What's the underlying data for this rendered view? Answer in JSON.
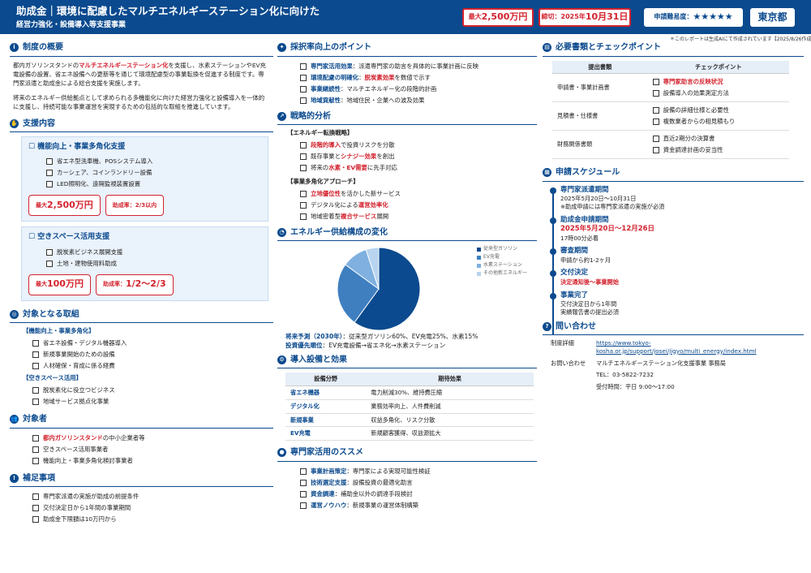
{
  "header": {
    "title": "助成金｜環境に配慮したマルチエネルギーステーション化に向けた",
    "subtitle": "経営力強化・設備導入等支援事業",
    "max_amount_prefix": "最大",
    "max_amount": "2,500万円",
    "deadline_label": "締切：",
    "deadline_year": "2025年",
    "deadline_date": "10月31日",
    "difficulty_label": "申請難易度：",
    "difficulty_stars": "★★★★★",
    "prefecture": "東京都"
  },
  "note": "＊このレポートは生成AIにて作成されています【2025/8/26作成】",
  "overview": {
    "title": "制度の概要",
    "p1_a": "都内ガソリンスタンドの",
    "p1_hl": "マルチエネルギーステーション化",
    "p1_b": "を支援し、水素ステーションやEV充電設備の設置、省エネ設備への更新等を通じて環境配慮型の事業転換を促進する制度です。専門家派遣と助成金による総合支援を実施します。",
    "p2": "将来のエネルギー供給拠点として求められる多機能化に向けた経営力強化と設備導入を一体的に支援し、持続可能な事業運営を実現するための包括的な取組を推進しています。"
  },
  "support": {
    "title": "支援内容",
    "box1": {
      "title": "機能向上・事業多角化支援",
      "items": [
        "省エネ型洗車機、POSシステム導入",
        "カーシェア、コインランドリー設備",
        "LED照明化、遠隔監視装置設置"
      ],
      "max_prefix": "最大",
      "max": "2,500万円",
      "rate": "助成率：2/3以内"
    },
    "box2": {
      "title": "空きスペース活用支援",
      "items": [
        "脱炭素ビジネス展開支援",
        "土地・建物使用料助成"
      ],
      "max_prefix": "最大",
      "max": "100万円",
      "rate_label": "助成率：",
      "rate": "1/2〜2/3"
    }
  },
  "targets": {
    "title": "対象となる取組",
    "tag1": "【機能向上・事業多角化】",
    "items1": [
      "省エネ設備・デジタル機器導入",
      "新規事業開始のための設備",
      "人材確保・育成に係る経費"
    ],
    "tag2": "【空きスペース活用】",
    "items2": [
      "脱炭素化に役立つビジネス",
      "地域サービス拠点化事業"
    ]
  },
  "eligible": {
    "title": "対象者",
    "item1_hl": "都内ガソリンスタンド",
    "item1_rest": "の中小企業者等",
    "items": [
      "空きスペース活用事業者",
      "機能向上・事業多角化検討事業者"
    ]
  },
  "supplement": {
    "title": "補足事項",
    "items": [
      "専門家派遣の実施が助成の前提条件",
      "交付決定日から1年間の事業期間",
      "助成金下限額は10万円から"
    ]
  },
  "points": {
    "title": "採択率向上のポイント",
    "items": [
      {
        "label": "専門家活用効果",
        "sep": "：",
        "rest": "派遣専門家の助言を具体的に事業計画に反映"
      },
      {
        "label": "環境配慮の明確化",
        "sep": "：",
        "hl": "脱炭素効果",
        "rest": "を数値で示す"
      },
      {
        "label": "事業継続性",
        "sep": "：",
        "rest": "マルチエネルギー化の段階的計画"
      },
      {
        "label": "地域貢献性",
        "sep": "：",
        "rest": "地域住民・企業への波及効果"
      }
    ]
  },
  "strategy": {
    "title": "戦略的分析",
    "tag1": "【エネルギー転換戦略】",
    "tag2": "【事業多角化アプローチ】"
  },
  "energy": {
    "title": "エネルギー供給構成の変化",
    "forecast_label": "将来予測（2030年）",
    "forecast_text": "：従来型ガソリン60%、EV充電25%、水素15%",
    "priority_label": "投資優先順位",
    "priority_text": "：EV充電設備→省エネ化→水素ステーション"
  },
  "equipment": {
    "title": "導入設備と効果",
    "headers": [
      "設備分野",
      "期待効果"
    ],
    "rows": [
      [
        "省エネ機器",
        "電力削減30%、維持費圧縮"
      ],
      [
        "デジタル化",
        "業務効率向上、人件費削減"
      ],
      [
        "新規事業",
        "収益多角化、リスク分散"
      ],
      [
        "EV充電",
        "新規顧客獲得、収益源拡大"
      ]
    ]
  },
  "expert": {
    "title": "専門家活用のススメ",
    "items": [
      {
        "label": "事業計画策定",
        "rest": "：専門家による実現可能性検証"
      },
      {
        "label": "技術選定支援",
        "rest": "：設備投資の最適化助言"
      },
      {
        "label": "資金調達",
        "rest": "：補助金以外の調達手段検討"
      },
      {
        "label": "運営ノウハウ",
        "rest": "：新規事業の運営体制構築"
      }
    ]
  },
  "docs": {
    "title": "必要書類とチェックポイント",
    "headers": [
      "提出書類",
      "チェックポイント"
    ],
    "rows": [
      {
        "doc": "申請書・事業計画書",
        "checks": [
          "専門家助言の反映状況",
          "設備導入の効果測定方法"
        ]
      },
      {
        "doc": "見積書・仕様書",
        "checks": [
          "設備の詳細仕様と必要性",
          "複数業者からの相見積もり"
        ]
      },
      {
        "doc": "財務関係書類",
        "checks": [
          "直近2期分の決算書",
          "資金調達計画の妥当性"
        ]
      }
    ]
  },
  "schedule": {
    "title": "申請スケジュール",
    "items": [
      {
        "head": "専門家派遣期間",
        "lines": [
          "2025年5月20日〜10月31日",
          "※助成申請には専門家派遣の実施が必須"
        ]
      },
      {
        "head": "助成金申請期間",
        "red": "2025年5月20日〜12月26日",
        "lines": [
          "17時00分必着"
        ]
      },
      {
        "head": "審査期間",
        "lines": [
          "申請から約1-2ヶ月"
        ]
      },
      {
        "head": "交付決定",
        "red_small": "決定通知後〜事業開始",
        "lines": []
      },
      {
        "head": "事業完了",
        "lines": [
          "交付決定日から1年間",
          "実績報告書の提出必須"
        ]
      }
    ]
  },
  "contact": {
    "title": "問い合わせ",
    "detail_label": "制度詳細",
    "url": "https://www.tokyo-kosha.or.jp/support/josei/jigyo/multi_energy/index.html",
    "inquiry_label": "お問い合わせ",
    "office": "マルチエネルギーステーション化支援事業 事務局",
    "tel": "TEL：03-5822-7232",
    "hours": "受付時間：平日 9:00〜17:00"
  },
  "chart_data": {
    "type": "pie",
    "categories": [
      "従来型ガソリン",
      "EV充電",
      "水素ステーション",
      "その他新エネルギー"
    ],
    "values": [
      60,
      25,
      10,
      5
    ],
    "colors": [
      "#0b4a8e",
      "#3f7fc0",
      "#7fb0e0",
      "#b8d4ef"
    ]
  }
}
